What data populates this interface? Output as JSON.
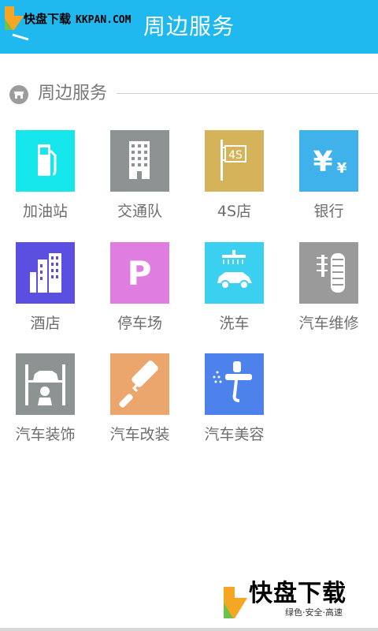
{
  "header": {
    "title": "周边服务",
    "accent_color": "#1fb9f0",
    "back_icon": "back-arrow-icon"
  },
  "watermark": {
    "top_text": "快盘下载",
    "top_url": "KKPAN.COM",
    "bottom_big": "快盘下载",
    "bottom_small": "绿色·安全·高速"
  },
  "section": {
    "title": "周边服务",
    "icon": "shop-icon"
  },
  "services": [
    {
      "label": "加油站",
      "icon": "gas-station-icon",
      "color": "#14e6ec"
    },
    {
      "label": "交通队",
      "icon": "office-building-icon",
      "color": "#8d9392"
    },
    {
      "label": "4S店",
      "icon": "4s-sign-icon",
      "color": "#d4b35a"
    },
    {
      "label": "银行",
      "icon": "yen-icon",
      "color": "#3fb2ec"
    },
    {
      "label": "酒店",
      "icon": "hotel-icon",
      "color": "#5a4fe1"
    },
    {
      "label": "停车场",
      "icon": "parking-icon",
      "color": "#e07de0"
    },
    {
      "label": "洗车",
      "icon": "car-wash-icon",
      "color": "#3bd0ef"
    },
    {
      "label": "汽车维修",
      "icon": "tire-repair-icon",
      "color": "#9a9a9a"
    },
    {
      "label": "汽车装饰",
      "icon": "car-lift-icon",
      "color": "#8d9392"
    },
    {
      "label": "汽车改装",
      "icon": "paint-roller-icon",
      "color": "#eba66e"
    },
    {
      "label": "汽车美容",
      "icon": "spray-gun-icon",
      "color": "#4d82ec"
    }
  ]
}
